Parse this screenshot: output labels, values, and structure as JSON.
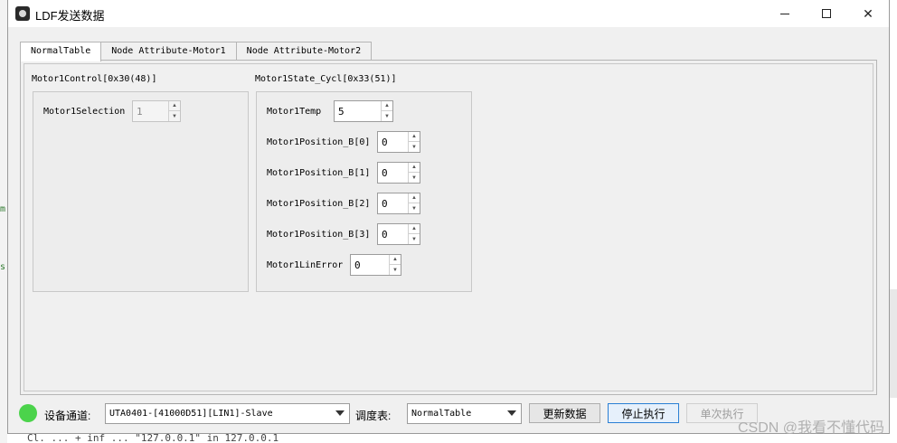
{
  "window": {
    "title": "LDF发送数据",
    "minimize_label": "–",
    "close_label": "✕"
  },
  "tabs": [
    {
      "label": "NormalTable"
    },
    {
      "label": "Node Attribute-Motor1"
    },
    {
      "label": "Node Attribute-Motor2"
    }
  ],
  "groups": {
    "control": {
      "label": "Motor1Control[0x30(48)]",
      "fields": [
        {
          "label": "Motor1Selection",
          "value": "1"
        }
      ]
    },
    "state": {
      "label": "Motor1State_Cycl[0x33(51)]",
      "fields": [
        {
          "label": "Motor1Temp",
          "value": "5"
        },
        {
          "label": "Motor1Position_B[0]",
          "value": "0"
        },
        {
          "label": "Motor1Position_B[1]",
          "value": "0"
        },
        {
          "label": "Motor1Position_B[2]",
          "value": "0"
        },
        {
          "label": "Motor1Position_B[3]",
          "value": "0"
        },
        {
          "label": "Motor1LinError",
          "value": "0"
        }
      ]
    }
  },
  "bottom": {
    "channel_label": "设备通道:",
    "channel_value": "UTA0401-[41000D51][LIN1]-Slave",
    "schedule_label": "调度表:",
    "schedule_value": "NormalTable",
    "update_button": "更新数据",
    "stop_button": "停止执行",
    "single_button": "单次执行",
    "status_color": "#4bd34b"
  },
  "background": {
    "left_chars": [
      "m",
      "s"
    ],
    "bottom_text": "Cl. ... + inf ... \"127.0.0.1\"  in 127.0.0.1"
  },
  "watermark": "CSDN @我看不懂代码"
}
